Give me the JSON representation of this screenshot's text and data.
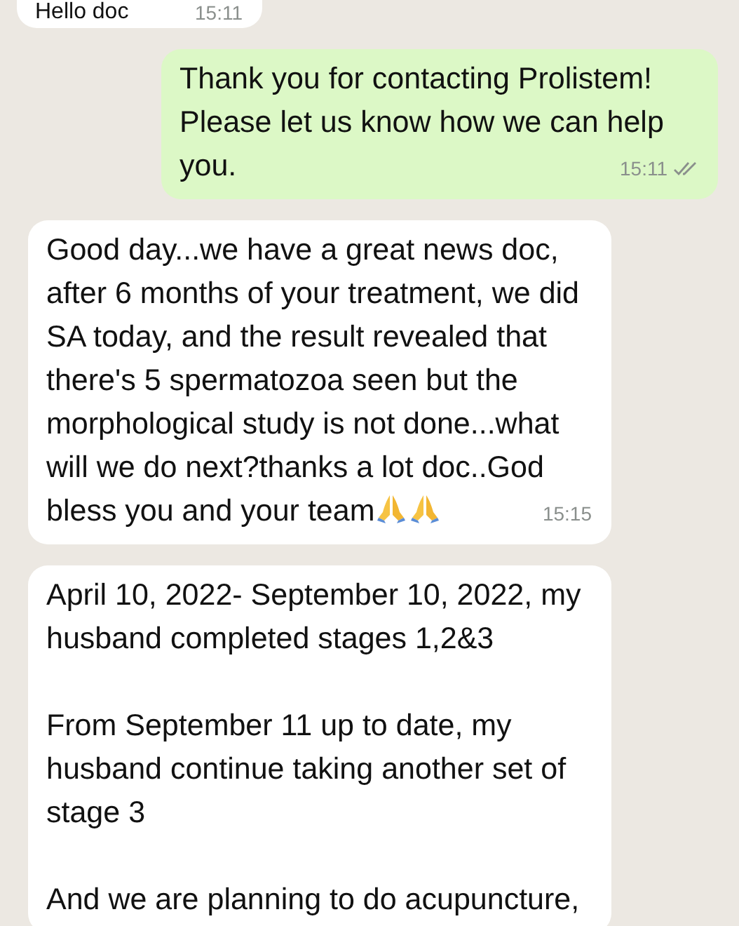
{
  "messages": [
    {
      "kind": "incoming",
      "paragraphs": [
        "Hello doc"
      ],
      "time": "15:11"
    },
    {
      "kind": "outgoing",
      "paragraphs": [
        "Thank you for contacting Prolistem! Please let us know how we can help you."
      ],
      "time": "15:11",
      "read": false
    },
    {
      "kind": "incoming",
      "paragraphs": [
        "Good day...we have a great news doc, after 6 months of your treatment, we did SA today, and the result revealed that there's 5 spermatozoa seen but the morphological study is not done...what will we do next?thanks a lot doc..God bless you and your team"
      ],
      "time": "15:15",
      "emoji": [
        {
          "kind": "praying-hands"
        },
        {
          "kind": "praying-hands"
        }
      ]
    },
    {
      "kind": "incoming",
      "paragraphs": [
        "April 10, 2022- September 10, 2022, my husband completed stages 1,2&3",
        "From September 11 up to date, my husband continue taking another set of stage 3",
        "And we are planning to do acupuncture,"
      ]
    }
  ]
}
